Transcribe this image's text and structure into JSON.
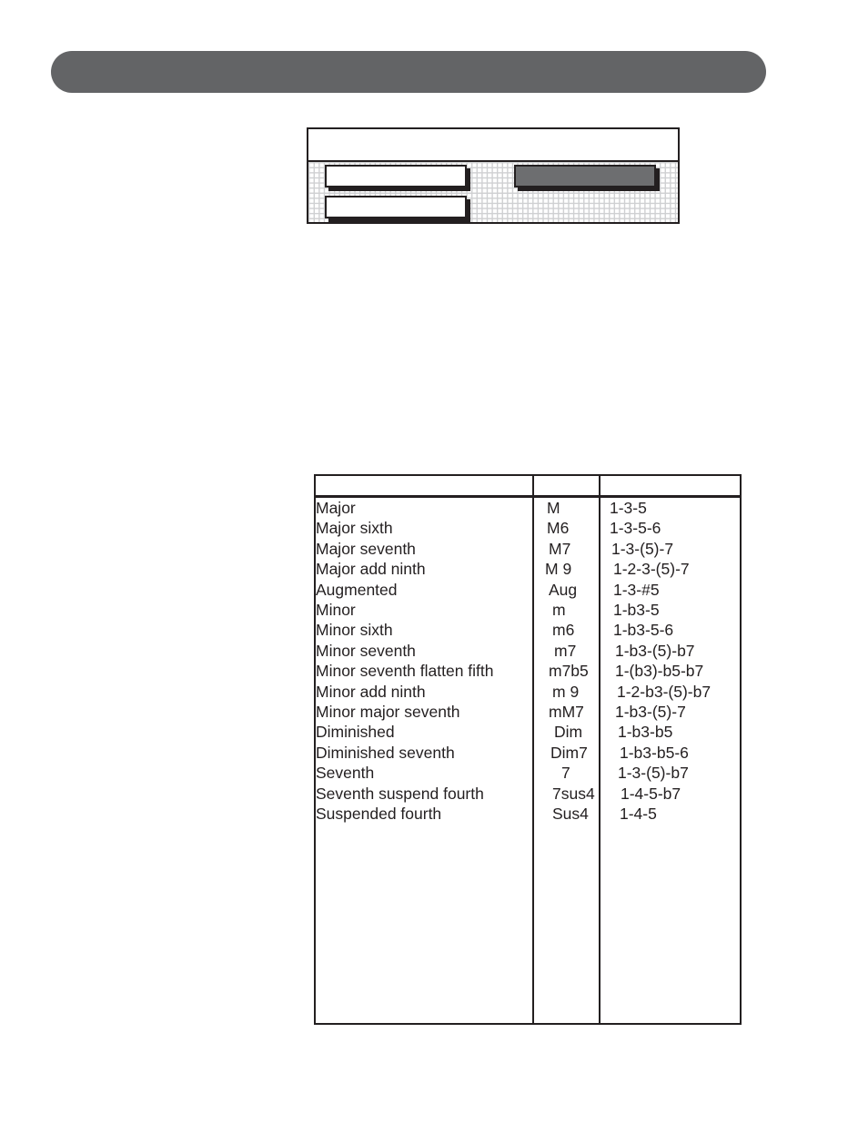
{
  "header": {
    "title": ""
  },
  "panel": {
    "title": "",
    "buttons": [
      {
        "label": "",
        "state": "normal"
      },
      {
        "label": "",
        "state": "normal"
      },
      {
        "label": "",
        "state": "selected"
      }
    ]
  },
  "chord_table": {
    "headers": [
      "",
      "",
      ""
    ],
    "rows": [
      {
        "name": "Major",
        "abbr": "M",
        "notes": "1-3-5"
      },
      {
        "name": "Major sixth",
        "abbr": "M6",
        "notes": "1-3-5-6"
      },
      {
        "name": "Major seventh",
        "abbr": "M7",
        "notes": "1-3-(5)-7"
      },
      {
        "name": "Major add ninth",
        "abbr": "M 9",
        "notes": "1-2-3-(5)-7"
      },
      {
        "name": "Augmented",
        "abbr": "Aug",
        "notes": "1-3-#5"
      },
      {
        "name": "Minor",
        "abbr": "m",
        "notes": "1-b3-5"
      },
      {
        "name": "Minor sixth",
        "abbr": "m6",
        "notes": "1-b3-5-6"
      },
      {
        "name": "Minor seventh",
        "abbr": "m7",
        "notes": "1-b3-(5)-b7"
      },
      {
        "name": "Minor seventh flatten fifth",
        "abbr": "m7b5",
        "notes": "1-(b3)-b5-b7"
      },
      {
        "name": "Minor add ninth",
        "abbr": "m 9",
        "notes": "1-2-b3-(5)-b7"
      },
      {
        "name": "Minor major seventh",
        "abbr": "mM7",
        "notes": "1-b3-(5)-7"
      },
      {
        "name": "Diminished",
        "abbr": "Dim",
        "notes": "1-b3-b5"
      },
      {
        "name": "Diminished seventh",
        "abbr": "Dim7",
        "notes": "1-b3-b5-6"
      },
      {
        "name": "Seventh",
        "abbr": "7",
        "notes": "1-3-(5)-b7"
      },
      {
        "name": "Seventh suspend fourth",
        "abbr": "7sus4",
        "notes": "1-4-5-b7"
      },
      {
        "name": "Suspended fourth",
        "abbr": "Sus4",
        "notes": "1-4-5"
      }
    ]
  },
  "colors": {
    "header_bar": "#636466",
    "selected_button": "#6d6e70",
    "grid": "#cfd0d2",
    "ink": "#231f20"
  }
}
